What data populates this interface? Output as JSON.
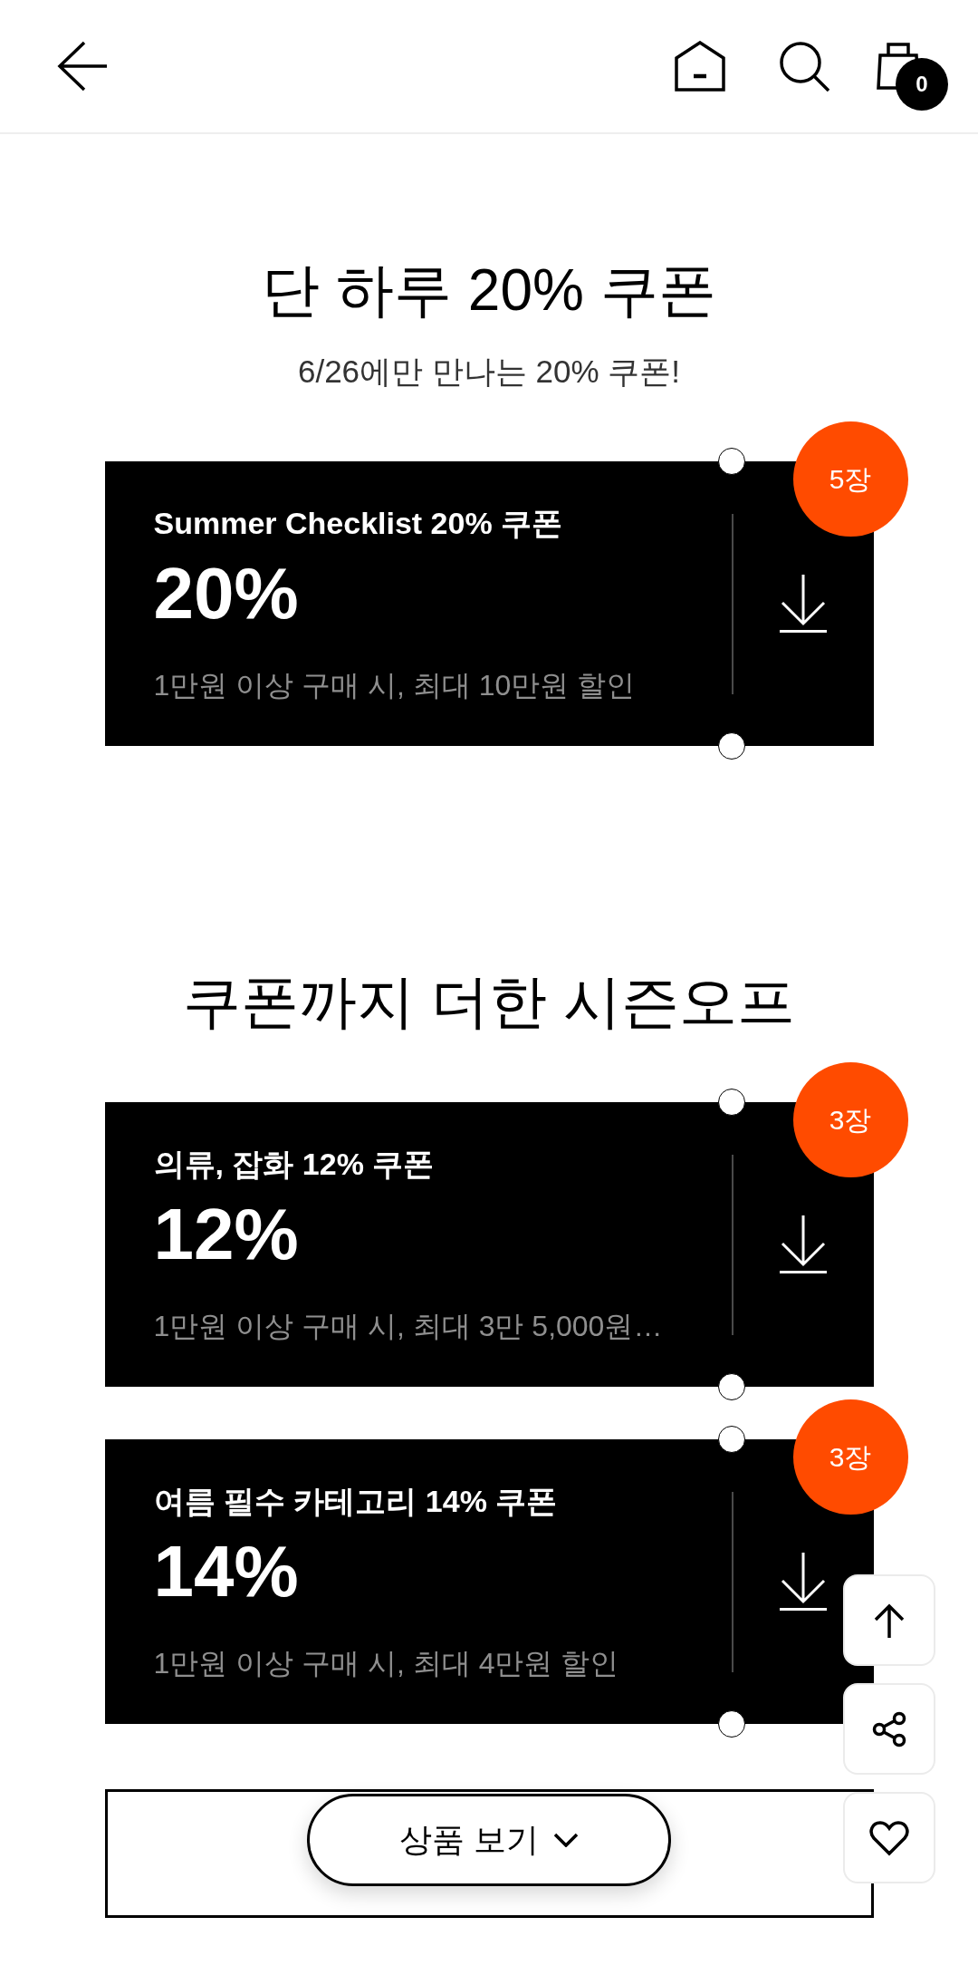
{
  "header": {
    "cart_count": "0"
  },
  "sections": [
    {
      "title": "단 하루 20% 쿠폰",
      "subtitle": "6/26에만 만나는 20% 쿠폰!",
      "coupons": [
        {
          "name": "Summer Checklist 20% 쿠폰",
          "discount": "20%",
          "condition": "1만원 이상 구매 시, 최대 10만원 할인",
          "quantity": "5장"
        }
      ]
    },
    {
      "title": "쿠폰까지 더한 시즌오프",
      "coupons": [
        {
          "name": "의류, 잡화 12% 쿠폰",
          "discount": "12%",
          "condition": "1만원 이상 구매 시, 최대 3만 5,000원…",
          "quantity": "3장"
        },
        {
          "name": "여름 필수 카테고리 14% 쿠폰",
          "discount": "14%",
          "condition": "1만원 이상 구매 시, 최대 4만원 할인",
          "quantity": "3장"
        }
      ]
    }
  ],
  "view_products_button": {
    "label": "상품 보기"
  }
}
